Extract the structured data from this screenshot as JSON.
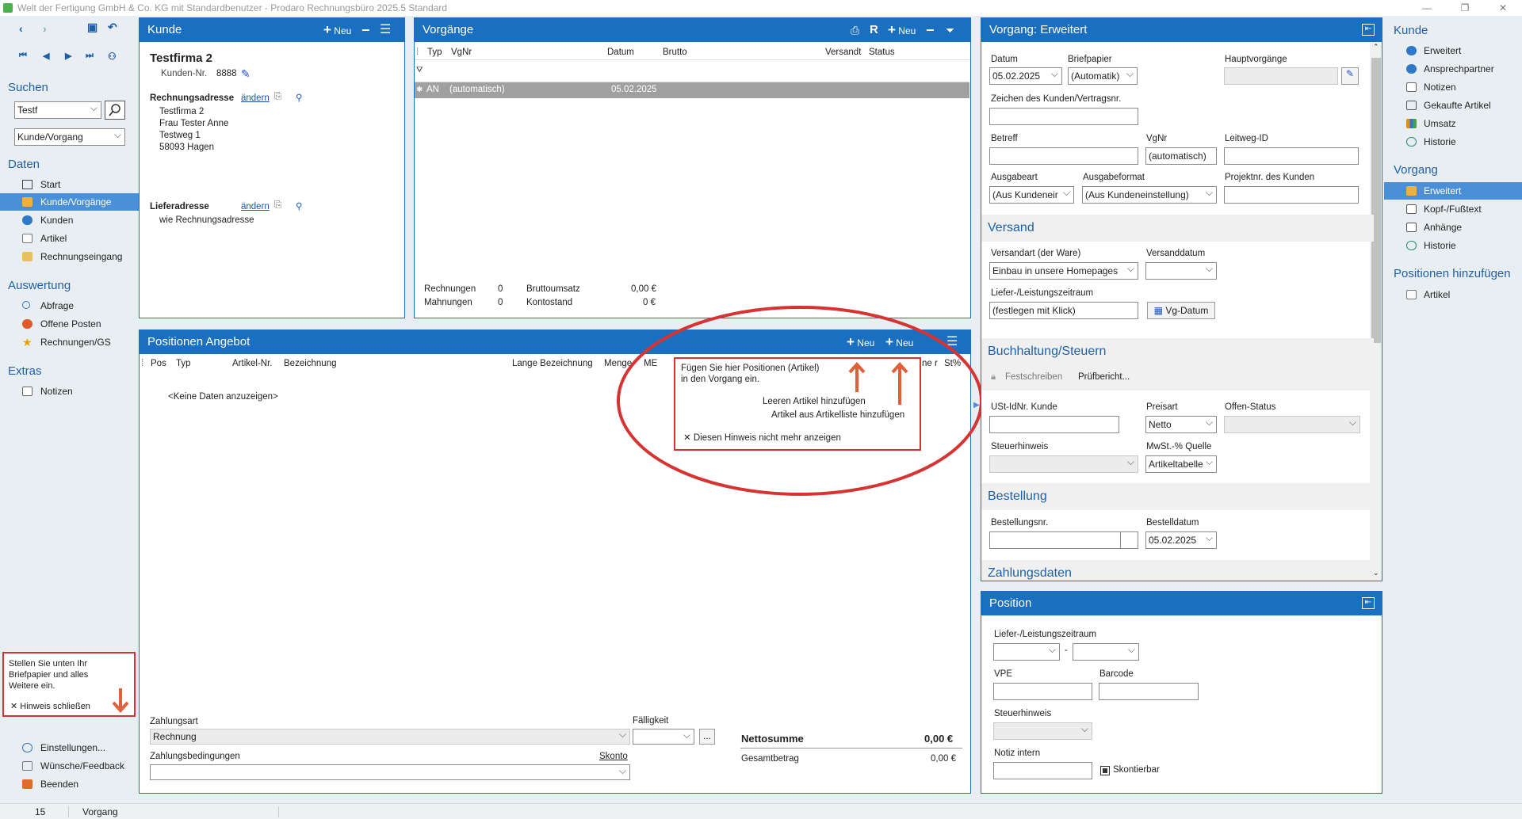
{
  "window": {
    "title": "Welt der Fertigung GmbH & Co. KG mit Standardbenutzer  -  Prodaro Rechnungsbüro 2025.5 Standard"
  },
  "sidebar": {
    "search_heading": "Suchen",
    "search_value": "Testf",
    "search_scope": "Kunde/Vorgang",
    "daten_heading": "Daten",
    "daten_items": [
      "Start",
      "Kunde/Vorgänge",
      "Kunden",
      "Artikel",
      "Rechnungseingang"
    ],
    "auswertung_heading": "Auswertung",
    "auswertung_items": [
      "Abfrage",
      "Offene Posten",
      "Rechnungen/GS"
    ],
    "extras_heading": "Extras",
    "extras_items": [
      "Notizen"
    ],
    "hint_text": "Stellen Sie unten Ihr Briefpapier und alles Weitere ein.",
    "hint_close": "Hinweis schließen",
    "bottom_items": [
      "Einstellungen...",
      "Wünsche/Feedback",
      "Beenden"
    ]
  },
  "kunde": {
    "title": "Kunde",
    "new_label": "Neu",
    "name": "Testfirma 2",
    "number_label": "Kunden-Nr.",
    "number": "8888",
    "billing_label": "Rechnungsadresse",
    "change_label": "ändern",
    "billing_lines": [
      "Testfirma 2",
      "Frau Tester Anne",
      "Testweg 1",
      "58093 Hagen"
    ],
    "delivery_label": "Lieferadresse",
    "delivery_value": "wie Rechnungsadresse"
  },
  "vorgaenge": {
    "title": "Vorgänge",
    "new_label": "Neu",
    "columns": [
      "Typ",
      "VgNr",
      "Datum",
      "Brutto",
      "Versandt",
      "Status"
    ],
    "row": {
      "typ": "AN",
      "vgnr": "(automatisch)",
      "datum": "05.02.2025"
    },
    "summary": {
      "rechnungen_label": "Rechnungen",
      "rechnungen": "0",
      "mahnungen_label": "Mahnungen",
      "mahnungen": "0",
      "bruttoumsatz_label": "Bruttoumsatz",
      "bruttoumsatz": "0,00 €",
      "kontostand_label": "Kontostand",
      "kontostand": "0 €"
    }
  },
  "positionen": {
    "title": "Positionen Angebot",
    "new1": "Neu",
    "new2": "Neu",
    "columns": [
      "Pos",
      "Typ",
      "Artikel-Nr.",
      "Bezeichnung",
      "Lange Bezeichnung",
      "Menge",
      "ME",
      "ne r",
      "St%"
    ],
    "empty": "<Keine Daten anzuzeigen>",
    "hint": {
      "line1": "Fügen Sie hier Positionen (Artikel)",
      "line2": "in den Vorgang ein.",
      "add_empty": "Leeren Artikel hinzufügen",
      "add_list": "Artikel aus Artikelliste hinzufügen",
      "dismiss": "Diesen Hinweis nicht mehr anzeigen"
    },
    "zahlungsart_label": "Zahlungsart",
    "zahlungsart": "Rechnung",
    "faelligkeit_label": "Fälligkeit",
    "ellipsis": "...",
    "zahlungsbedingungen_label": "Zahlungsbedingungen",
    "skonto": "Skonto",
    "nettosumme_label": "Nettosumme",
    "nettosumme": "0,00  €",
    "gesamtbetrag_label": "Gesamtbetrag",
    "gesamtbetrag": "0,00  €"
  },
  "erweitert": {
    "title": "Vorgang: Erweitert",
    "datum_label": "Datum",
    "datum": "05.02.2025",
    "briefpapier_label": "Briefpapier",
    "briefpapier": "(Automatik)",
    "hauptvorgaenge_label": "Hauptvorgänge",
    "zeichen_label": "Zeichen des Kunden/Vertragsnr.",
    "betreff_label": "Betreff",
    "vgnr_label": "VgNr",
    "vgnr": "(automatisch)",
    "leitweg_label": "Leitweg-ID",
    "ausgabeart_label": "Ausgabeart",
    "ausgabeart": "(Aus Kundeneir",
    "ausgabeformat_label": "Ausgabeformat",
    "ausgabeformat": "(Aus Kundeneinstellung)",
    "projektnr_label": "Projektnr. des Kunden",
    "versand_heading": "Versand",
    "versandart_label": "Versandart (der Ware)",
    "versandart": "Einbau in unsere Homepages",
    "versanddatum_label": "Versanddatum",
    "liefer_label": "Liefer-/Leistungszeitraum",
    "liefer": "(festlegen mit Klick)",
    "vgdatum_btn": "Vg-Datum",
    "buchhaltung_heading": "Buchhaltung/Steuern",
    "festschreiben": "Festschreiben",
    "pruefbericht": "Prüfbericht...",
    "ustid_label": "USt-IdNr. Kunde",
    "preisart_label": "Preisart",
    "preisart": "Netto",
    "offen_label": "Offen-Status",
    "steuerhinweis_label": "Steuerhinweis",
    "mwst_label": "MwSt.-% Quelle",
    "mwst": "Artikeltabelle",
    "bestellung_heading": "Bestellung",
    "bestellnr_label": "Bestellungsnr.",
    "bestelldatum_label": "Bestelldatum",
    "bestelldatum": "05.02.2025",
    "zahlungsdaten_heading": "Zahlungsdaten"
  },
  "position": {
    "title": "Position",
    "liefer_label": "Liefer-/Leistungszeitraum",
    "dash": "-",
    "vpe_label": "VPE",
    "barcode_label": "Barcode",
    "steuerhinweis_label": "Steuerhinweis",
    "notiz_label": "Notiz intern",
    "skontierbar": "Skontierbar"
  },
  "right_sidebar": {
    "kunde_heading": "Kunde",
    "kunde_items": [
      "Erweitert",
      "Ansprechpartner",
      "Notizen",
      "Gekaufte Artikel",
      "Umsatz",
      "Historie"
    ],
    "vorgang_heading": "Vorgang",
    "vorgang_items": [
      "Erweitert",
      "Kopf-/Fußtext",
      "Anhänge",
      "Historie"
    ],
    "positionen_heading": "Positionen hinzufügen",
    "positionen_items": [
      "Artikel"
    ]
  },
  "statusbar": {
    "count": "15",
    "label": "Vorgang"
  },
  "colors": {
    "accent": "#1a6fc0",
    "highlight": "#d63333",
    "arrow": "#e0603a"
  }
}
